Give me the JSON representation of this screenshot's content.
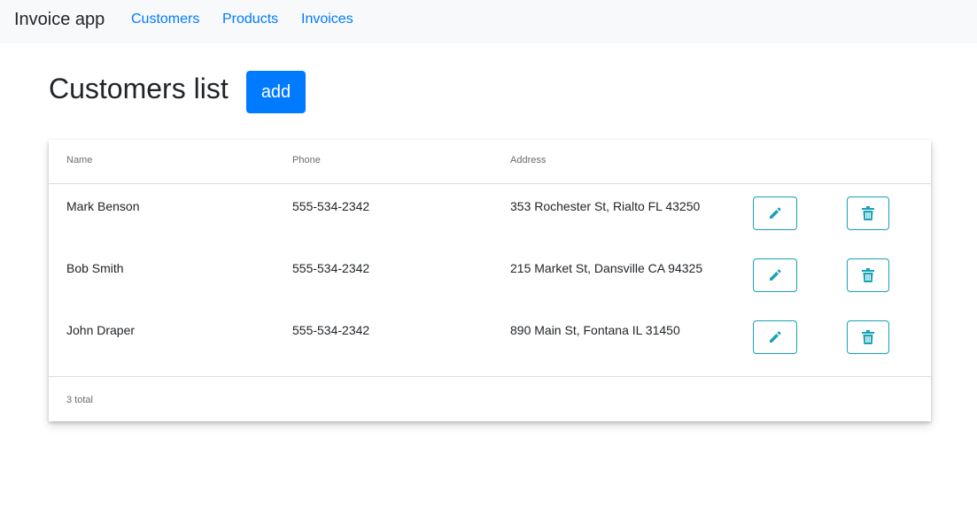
{
  "navbar": {
    "brand": "Invoice app",
    "links": [
      {
        "label": "Customers"
      },
      {
        "label": "Products"
      },
      {
        "label": "Invoices"
      }
    ]
  },
  "page": {
    "title": "Customers list",
    "add_label": "add"
  },
  "table": {
    "columns": [
      "Name",
      "Phone",
      "Address"
    ],
    "rows": [
      {
        "name": "Mark Benson",
        "phone": "555-534-2342",
        "address": "353 Rochester St, Rialto FL 43250"
      },
      {
        "name": "Bob Smith",
        "phone": "555-534-2342",
        "address": "215 Market St, Dansville CA 94325"
      },
      {
        "name": "John Draper",
        "phone": "555-534-2342",
        "address": "890 Main St, Fontana IL 31450"
      }
    ],
    "row_actions": [
      {
        "icon": "pencil-icon"
      },
      {
        "icon": "trash-icon"
      }
    ],
    "total_text": "3 total"
  },
  "colors": {
    "accent": "#007bff",
    "action_outline": "#17a2b8",
    "navbar_bg": "#f8f9fa"
  }
}
